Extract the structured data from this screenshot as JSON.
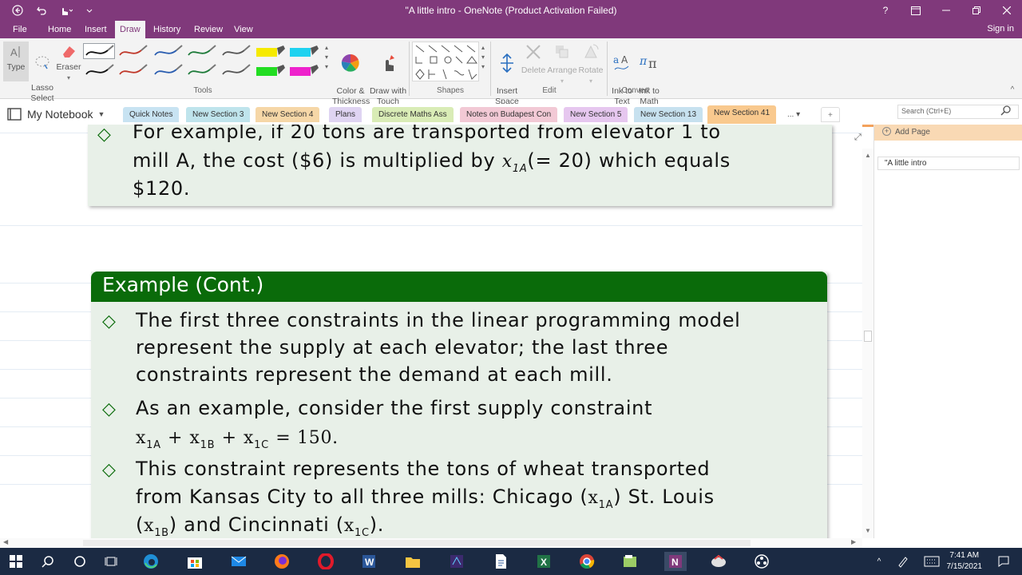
{
  "window": {
    "title": "\"A little intro - OneNote (Product Activation Failed)",
    "help": "?",
    "sign_in": "Sign in"
  },
  "menu_tabs": [
    "File",
    "Home",
    "Insert",
    "Draw",
    "History",
    "Review",
    "View"
  ],
  "active_menu_tab": "Draw",
  "ribbon": {
    "tools": {
      "type_label": "Type",
      "lasso_label": "Lasso\nSelect",
      "eraser_label": "Eraser",
      "group_label": "Tools"
    },
    "pens_row1": [
      "#111111",
      "#c0392b",
      "#2a5db0",
      "#1e7b3a",
      "#555555",
      "#f6ea00",
      "#1fd2f0"
    ],
    "pens_row2": [
      "#111111",
      "#c0392b",
      "#2a5db0",
      "#1e7b3a",
      "#555555",
      "#22dd22",
      "#ee22cc"
    ],
    "color_thickness_label": "Color &\nThickness",
    "draw_touch_label": "Draw with\nTouch",
    "shapes_label": "Shapes",
    "edit": {
      "insert_space": "Insert\nSpace",
      "delete": "Delete",
      "arrange": "Arrange",
      "rotate": "Rotate",
      "group_label": "Edit"
    },
    "convert": {
      "ink_to_text": "Ink to\nText",
      "ink_to_math": "Ink to\nMath",
      "group_label": "Convert"
    }
  },
  "notebook": {
    "name": "My Notebook",
    "sections": [
      {
        "label": "Quick Notes",
        "color": "#c8e3f2"
      },
      {
        "label": "New Section 3",
        "color": "#bfe4ec"
      },
      {
        "label": "New Section 4",
        "color": "#f6d7a7"
      },
      {
        "label": "Plans",
        "color": "#dfd4f2"
      },
      {
        "label": "Discrete Maths Ass",
        "color": "#d9ecb6"
      },
      {
        "label": "Notes on Budapest Con",
        "color": "#f2c9d5"
      },
      {
        "label": "New Section 5",
        "color": "#e6c7ef"
      },
      {
        "label": "New Section 13",
        "color": "#c7e1ef"
      },
      {
        "label": "New Section 41",
        "color": "#f9c98e"
      }
    ],
    "more": "...",
    "add": "+"
  },
  "search": {
    "placeholder": "Search (Ctrl+E)"
  },
  "pages": {
    "add_page": "Add Page",
    "items": [
      "\"A little intro"
    ]
  },
  "slide1": {
    "line1": "For example, if 20 tons are transported from elevator 1 to",
    "line2_pre": "mill A, the cost ($6) is multiplied by ",
    "var": "x",
    "var_sub": "1A",
    "line2_post": "(= 20) which equals",
    "line3": "$120."
  },
  "slide2": {
    "title": "Example (Cont.)",
    "b1": [
      "The first three constraints in the linear programming model",
      "represent the supply at each elevator; the last three",
      "constraints represent the demand at each mill."
    ],
    "b2": {
      "line1": "As an example, consider the first supply constraint",
      "math": {
        "x": "x",
        "s1": "1A",
        "s2": "1B",
        "s3": "1C",
        "plus": "+",
        "eq": "= 150."
      }
    },
    "b3": {
      "line1": "This constraint represents the tons of wheat transported",
      "line2_pre": "from Kansas City to all three mills: Chicago (",
      "line2_post": ") St. Louis",
      "line3_a": "(",
      "line3_b": ") and Cincinnati (",
      "line3_c": ").",
      "sub_a": "1A",
      "sub_b": "1B",
      "sub_c": "1C"
    }
  },
  "taskbar": {
    "time": "7:41 AM",
    "date": "7/15/2021"
  }
}
